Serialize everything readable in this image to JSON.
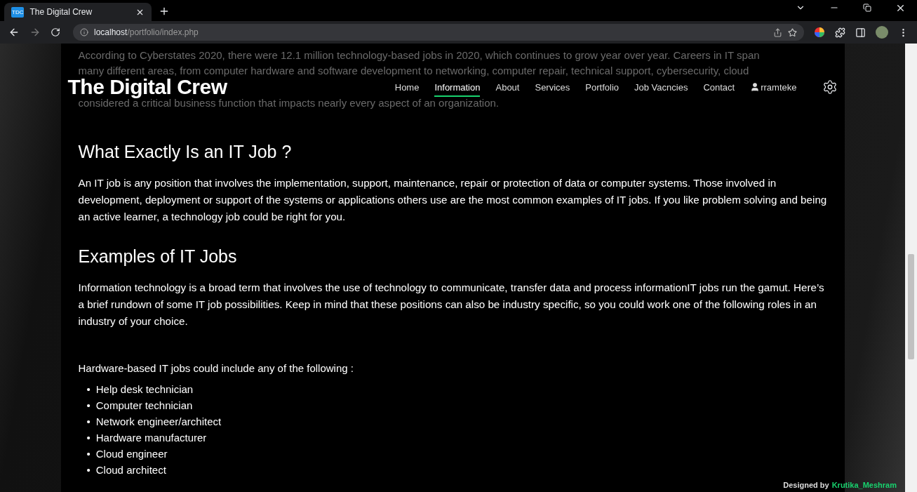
{
  "browser": {
    "tab_title": "The Digital Crew",
    "favicon": "TDC",
    "url_host": "localhost",
    "url_path": "/portfolio/index.php"
  },
  "underlying_text": [
    "According to Cyberstates 2020, there were 12.1 million technology-based jobs in 2020, which continues to grow year over year. Careers in IT span",
    "many different areas, from computer hardware and software development to networking, computer repair, technical support, cybersecurity, cloud",
    "considered a critical business function that impacts nearly every aspect of an organization."
  ],
  "header": {
    "logo": "The Digital Crew",
    "nav": [
      {
        "label": "Home",
        "selected": false
      },
      {
        "label": "Information",
        "selected": true
      },
      {
        "label": "About",
        "selected": false
      },
      {
        "label": "Services",
        "selected": false
      },
      {
        "label": "Portfolio",
        "selected": false
      },
      {
        "label": "Job Vacncies",
        "selected": false
      },
      {
        "label": "Contact",
        "selected": false
      }
    ],
    "user": "rramteke"
  },
  "sections": [
    {
      "heading": "What Exactly Is an IT Job ?",
      "paragraph": "An IT job is any position that involves the implementation, support, maintenance, repair or protection of data or computer systems. Those involved in development, deployment or support of the systems or applications others use are the most common examples of IT jobs. If you like problem solving and being an active learner, a technology job could be right for you."
    },
    {
      "heading": "Examples of IT Jobs",
      "paragraph": "Information technology is a broad term that involves the use of technology to communicate, transfer data and process informationIT jobs run the gamut. Here’s a brief rundown of some IT job possibilities. Keep in mind that these positions can also be industry specific, so you could work one of the following roles in an industry of your choice."
    }
  ],
  "list_intro": "Hardware-based IT jobs could include any of the following :",
  "bullet": "•",
  "list": [
    "Help desk technician",
    "Computer technician",
    "Network engineer/architect",
    "Hardware manufacturer",
    "Cloud engineer",
    "Cloud architect"
  ],
  "footer": {
    "prefix": "Designed by",
    "author": "Krutika_Meshram"
  }
}
